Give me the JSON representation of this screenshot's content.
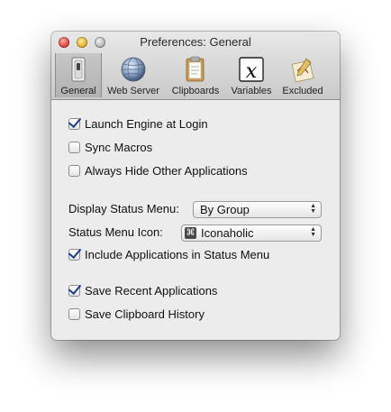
{
  "window": {
    "title": "Preferences: General"
  },
  "toolbar": {
    "tabs": [
      {
        "label": "General",
        "icon": "switch-icon",
        "selected": true
      },
      {
        "label": "Web Server",
        "icon": "globe-icon"
      },
      {
        "label": "Clipboards",
        "icon": "clipboard-icon"
      },
      {
        "label": "Variables",
        "icon": "variable-x-icon"
      },
      {
        "label": "Excluded",
        "icon": "excluded-app-icon"
      }
    ]
  },
  "options": {
    "launch_at_login": {
      "label": "Launch Engine at Login",
      "checked": true
    },
    "sync_macros": {
      "label": "Sync Macros",
      "checked": false
    },
    "always_hide": {
      "label": "Always Hide Other Applications",
      "checked": false
    },
    "display_status_menu": {
      "label": "Display Status Menu:",
      "value": "By Group"
    },
    "status_menu_icon": {
      "label": "Status Menu Icon:",
      "value": "Iconaholic",
      "value_icon": "⌘"
    },
    "include_apps": {
      "label": "Include Applications in Status Menu",
      "checked": true
    },
    "save_recent": {
      "label": "Save Recent Applications",
      "checked": true
    },
    "save_clipboard": {
      "label": "Save Clipboard History",
      "checked": false
    }
  },
  "colors": {
    "check_mark": "#1e3f85",
    "window_bg": "#ececec"
  }
}
